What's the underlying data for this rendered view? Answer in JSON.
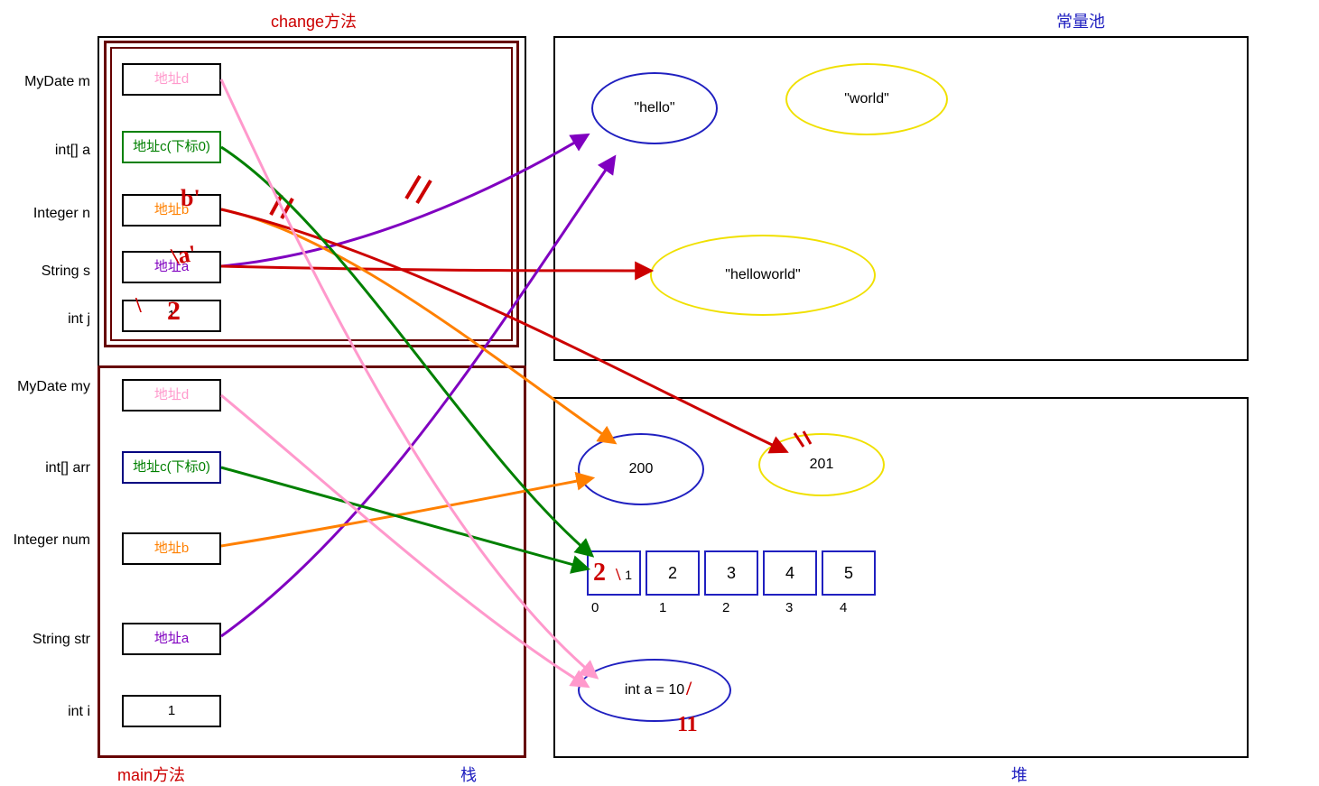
{
  "titles": {
    "change_method": "change方法",
    "main_method": "main方法",
    "stack": "栈",
    "heap": "堆",
    "const_pool": "常量池"
  },
  "stack_change": {
    "vars": {
      "mydate_m": "MyDate m",
      "int_arr_a": "int[] a",
      "integer_n": "Integer n",
      "string_s": "String s",
      "int_j": "int j"
    },
    "slots": {
      "addr_d": "地址d",
      "addr_c": "地址c(下标0)",
      "addr_b": "地址b",
      "addr_b_prime": "b'",
      "addr_a": "地址a",
      "addr_a_prime": "a'",
      "j_val": "1",
      "j_val_new": "2"
    }
  },
  "stack_main": {
    "vars": {
      "mydate_my": "MyDate my",
      "int_arr": "int[] arr",
      "integer_num": "Integer num",
      "string_str": "String str",
      "int_i": "int i"
    },
    "slots": {
      "addr_d": "地址d",
      "addr_c": "地址c(下标0)",
      "addr_b": "地址b",
      "addr_a": "地址a",
      "i_val": "1"
    }
  },
  "const_pool": {
    "hello": "\"hello\"",
    "world": "\"world\"",
    "helloworld": "\"helloworld\""
  },
  "heap": {
    "int200": "200",
    "int201": "201",
    "array": {
      "cells": [
        "1",
        "2",
        "3",
        "4",
        "5"
      ],
      "cell0_new": "2",
      "indices": [
        "0",
        "1",
        "2",
        "3",
        "4"
      ]
    },
    "mydate": {
      "text": "int a = 10",
      "new": "11"
    }
  },
  "cross_marks": {
    "slash": "//"
  }
}
